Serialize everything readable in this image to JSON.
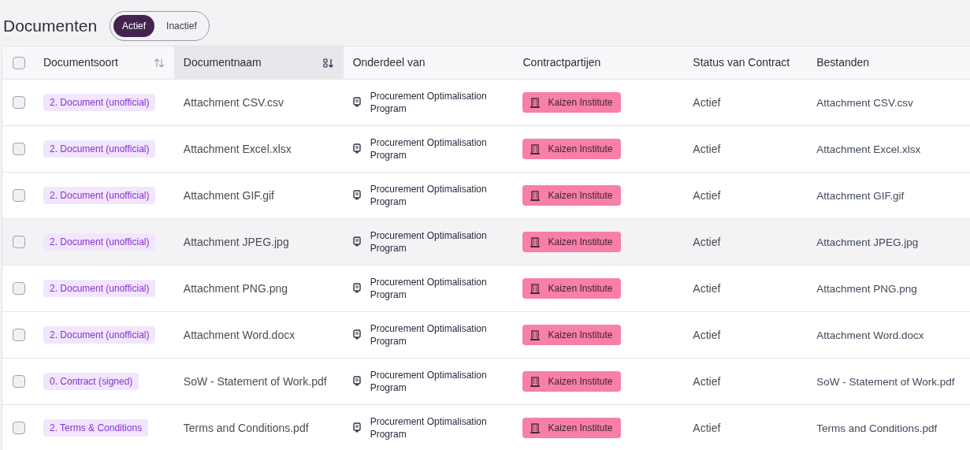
{
  "page": {
    "title": "Documenten"
  },
  "filter_toggle": [
    {
      "label": "Actief",
      "selected": true
    },
    {
      "label": "Inactief",
      "selected": false
    }
  ],
  "table": {
    "select_all": {
      "checked": false
    },
    "columns": [
      {
        "label": "Documentsoort",
        "kind": "sortable"
      },
      {
        "label": "Documentnaam",
        "kind": "sorted"
      },
      {
        "label": "Onderdeel van",
        "kind": "plain"
      },
      {
        "label": "Contractpartijen",
        "kind": "plain"
      },
      {
        "label": "Status van Contract",
        "kind": "plain"
      },
      {
        "label": "Bestanden",
        "kind": "plain"
      }
    ],
    "rows": [
      {
        "checked": false,
        "hovered": false,
        "type": "2. Document (unofficial)",
        "name": "Attachment CSV.csv",
        "part_of": "Procurement Optimalisation Program",
        "party": "Kaizen Institute",
        "status": "Actief",
        "file": "Attachment CSV.csv"
      },
      {
        "checked": false,
        "hovered": false,
        "type": "2. Document (unofficial)",
        "name": "Attachment Excel.xlsx",
        "part_of": "Procurement Optimalisation Program",
        "party": "Kaizen Institute",
        "status": "Actief",
        "file": "Attachment Excel.xlsx"
      },
      {
        "checked": false,
        "hovered": false,
        "type": "2. Document (unofficial)",
        "name": "Attachment GIF.gif",
        "part_of": "Procurement Optimalisation Program",
        "party": "Kaizen Institute",
        "status": "Actief",
        "file": "Attachment GIF.gif"
      },
      {
        "checked": false,
        "hovered": true,
        "type": "2. Document (unofficial)",
        "name": "Attachment JPEG.jpg",
        "part_of": "Procurement Optimalisation Program",
        "party": "Kaizen Institute",
        "status": "Actief",
        "file": "Attachment JPEG.jpg"
      },
      {
        "checked": false,
        "hovered": false,
        "type": "2. Document (unofficial)",
        "name": "Attachment PNG.png",
        "part_of": "Procurement Optimalisation Program",
        "party": "Kaizen Institute",
        "status": "Actief",
        "file": "Attachment PNG.png"
      },
      {
        "checked": false,
        "hovered": false,
        "type": "2. Document (unofficial)",
        "name": "Attachment Word.docx",
        "part_of": "Procurement Optimalisation Program",
        "party": "Kaizen Institute",
        "status": "Actief",
        "file": "Attachment Word.docx"
      },
      {
        "checked": false,
        "hovered": false,
        "type": "0. Contract (signed)",
        "name": "SoW - Statement of Work.pdf",
        "part_of": "Procurement Optimalisation Program",
        "party": "Kaizen Institute",
        "status": "Actief",
        "file": "SoW - Statement of Work.pdf"
      },
      {
        "checked": false,
        "hovered": false,
        "type": "2. Terms & Conditions",
        "name": "Terms and Conditions.pdf",
        "part_of": "Procurement Optimalisation Program",
        "party": "Kaizen Institute",
        "status": "Actief",
        "file": "Terms and Conditions.pdf"
      }
    ]
  }
}
